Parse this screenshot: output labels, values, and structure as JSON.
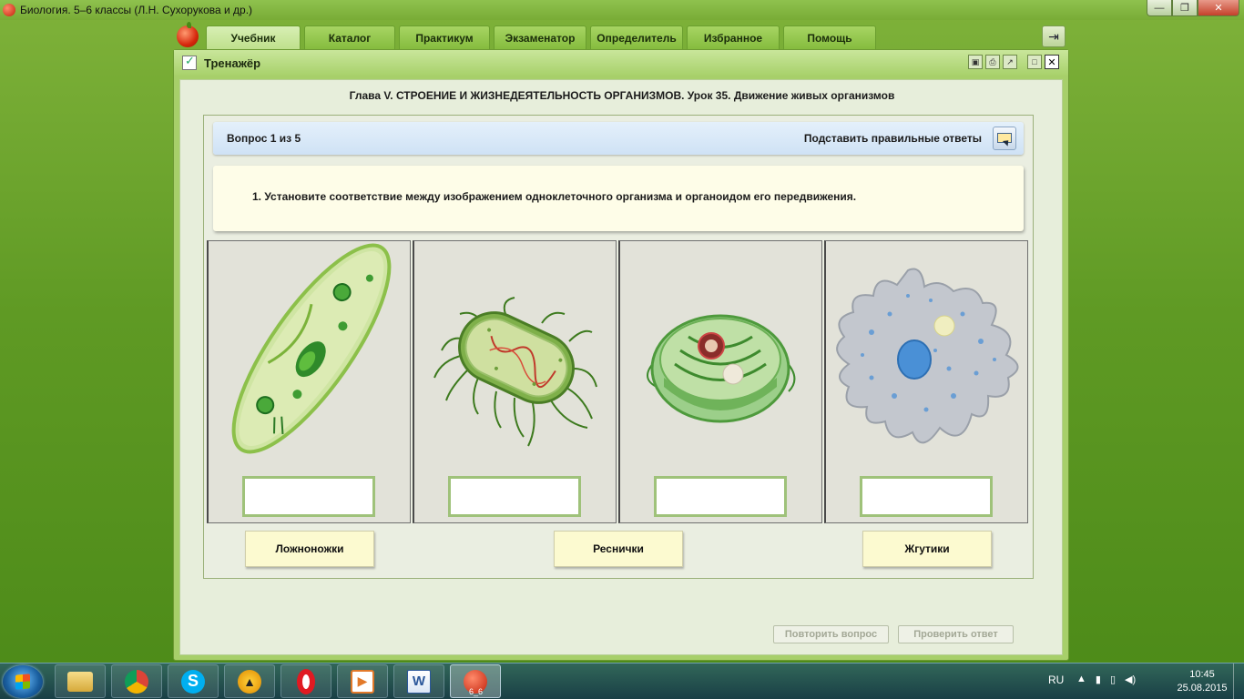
{
  "window": {
    "title": "Биология. 5–6 классы (Л.Н. Сухорукова и др.)",
    "minimize": "—",
    "maximize": "❐",
    "close": "✕"
  },
  "tabs": [
    {
      "label": "Учебник",
      "active": true
    },
    {
      "label": "Каталог",
      "active": false
    },
    {
      "label": "Практикум",
      "active": false
    },
    {
      "label": "Экзаменатор",
      "active": false
    },
    {
      "label": "Определитель",
      "active": false
    },
    {
      "label": "Избранное",
      "active": false
    },
    {
      "label": "Помощь",
      "active": false
    }
  ],
  "panel": {
    "title": "Тренажёр",
    "chapter": "Глава V. СТРОЕНИЕ И ЖИЗНЕДЕЯТЕЛЬНОСТЬ ОРГАНИЗМОВ. Урок 35. Движение живых организмов",
    "question_counter": "Вопрос 1 из 5",
    "fill_answers_label": "Подставить правильные ответы",
    "question_text": "1. Установите соответствие между изображением одноклеточного организма и органоидом его передвижения.",
    "organisms": [
      "paramecium-image",
      "bacterium-image",
      "plant-cell-image",
      "amoeba-image"
    ],
    "answers": [
      "Ложноножки",
      "Реснички",
      "Жгутики"
    ],
    "repeat_button": "Повторить вопрос",
    "check_button": "Проверить ответ"
  },
  "taskbar": {
    "apps": [
      "explorer-icon",
      "chrome-icon",
      "skype-icon",
      "aimp-icon",
      "opera-icon",
      "media-icon",
      "word-icon",
      "biology-app-icon"
    ],
    "active_app_label": "6_6",
    "lang": "RU",
    "time": "10:45",
    "date": "25.08.2015"
  },
  "colors": {
    "desktop": "#5f9a24",
    "panel_bg": "#a7cf6a",
    "answer_card": "#fcfad0",
    "question_bar": "#cfe2f5"
  }
}
